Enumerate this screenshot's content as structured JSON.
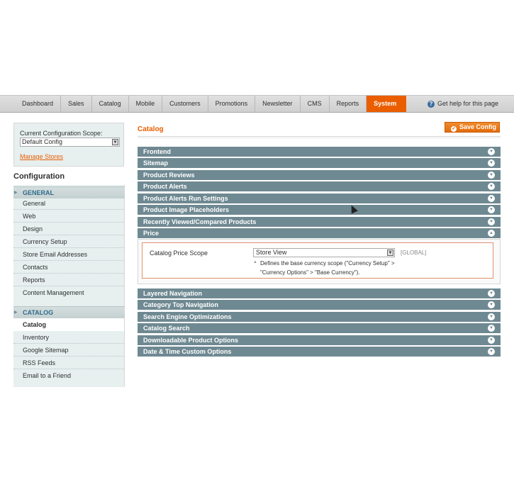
{
  "nav": {
    "items": [
      "Dashboard",
      "Sales",
      "Catalog",
      "Mobile",
      "Customers",
      "Promotions",
      "Newsletter",
      "CMS",
      "Reports",
      "System"
    ],
    "active": "System",
    "help": "Get help for this page"
  },
  "scope": {
    "label": "Current Configuration Scope:",
    "value": "Default Config",
    "manage": "Manage Stores"
  },
  "sidebar": {
    "title": "Configuration",
    "groups": [
      {
        "label": "GENERAL",
        "items": [
          "General",
          "Web",
          "Design",
          "Currency Setup",
          "Store Email Addresses",
          "Contacts",
          "Reports",
          "Content Management"
        ]
      },
      {
        "label": "CATALOG",
        "items": [
          "Catalog",
          "Inventory",
          "Google Sitemap",
          "RSS Feeds",
          "Email to a Friend"
        ]
      }
    ],
    "active": "Catalog"
  },
  "main": {
    "title": "Catalog",
    "save_label": "Save Config",
    "sections_top": [
      "Frontend",
      "Sitemap",
      "Product Reviews",
      "Product Alerts",
      "Product Alerts Run Settings",
      "Product Image Placeholders",
      "Recently Viewed/Compared Products",
      "Price"
    ],
    "price": {
      "field_label": "Catalog Price Scope",
      "field_value": "Store View",
      "scope_tag": "[GLOBAL]",
      "note_line1": "Defines the base currency scope (\"Currency Setup\" >",
      "note_line2": "\"Currency Options\" > \"Base Currency\")."
    },
    "sections_bottom": [
      "Layered Navigation",
      "Category Top Navigation",
      "Search Engine Optimizations",
      "Catalog Search",
      "Downloadable Product Options",
      "Date & Time Custom Options"
    ]
  }
}
